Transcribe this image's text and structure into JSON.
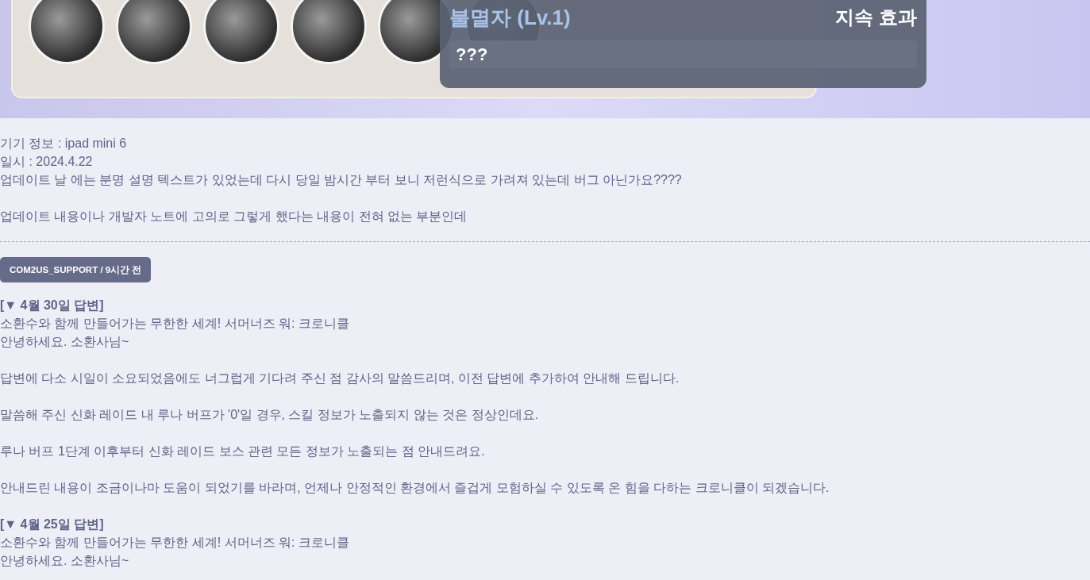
{
  "screenshot": {
    "tooltip": {
      "title": "불멸자 (Lv.1)",
      "effect_label": "지속 효과",
      "description": "???"
    }
  },
  "post": {
    "paragraphs": [
      [
        "기기 정보 : ipad mini 6",
        "일시 : 2024.4.22",
        "업데이트 날 에는 분명 설명 텍스트가 있었는데 다시 당일 밤시간 부터 보니 저런식으로 가려져 있는데 버그 아닌가요????"
      ],
      [
        "업데이트 내용이나 개발자 노트에 고의로 그렇게 했다는 내용이 전혀 없는 부분인데"
      ]
    ]
  },
  "answer": {
    "author_badge": "COM2US_SUPPORT / 9시간 전",
    "replies": [
      {
        "heading": "[▼ 4월 30일 답변]",
        "paragraphs": [
          [
            "소환수와 함께 만들어가는 무한한 세계! 서머너즈 워: 크로니클",
            "안녕하세요. 소환사님~"
          ],
          [
            "답변에 다소 시일이 소요되었음에도 너그럽게 기다려 주신 점 감사의 말씀드리며, 이전 답변에 추가하여 안내해 드립니다."
          ],
          [
            "말씀해 주신 신화 레이드 내 루나 버프가 '0'일 경우, 스킬 정보가 노출되지 않는 것은 정상인데요."
          ],
          [
            "루나 버프 1단계 이후부터 신화 레이드 보스 관련 모든 정보가 노출되는 점 안내드려요."
          ],
          [
            "안내드린 내용이 조금이나마 도움이 되었기를 바라며, 언제나 안정적인 환경에서 즐겁게 모험하실 수 있도록 온 힘을 다하는 크로니클이 되겠습니다."
          ]
        ]
      },
      {
        "heading": "[▼ 4월 25일 답변]",
        "paragraphs": [
          [
            "소환수와 함께 만들어가는 무한한 세계! 서머너즈 워: 크로니클",
            "안녕하세요. 소환사님~"
          ]
        ]
      }
    ]
  }
}
